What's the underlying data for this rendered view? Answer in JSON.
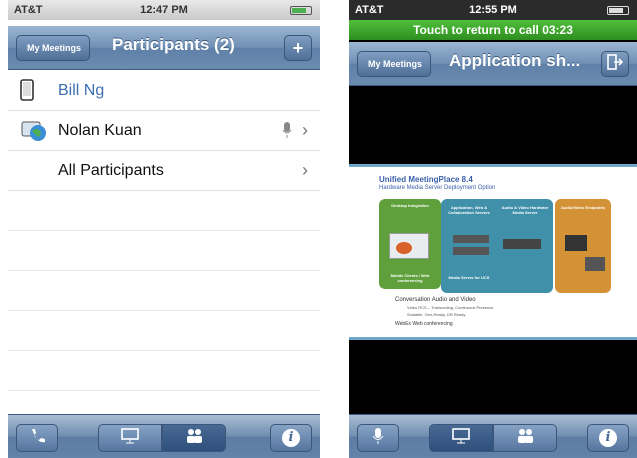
{
  "left": {
    "status": {
      "carrier": "AT&T",
      "time": "12:47 PM"
    },
    "nav": {
      "back": "My Meetings",
      "title": "Participants (2)",
      "add": "+"
    },
    "participants": [
      {
        "name": "Bill Ng"
      },
      {
        "name": "Nolan Kuan"
      },
      {
        "name": "All Participants"
      }
    ]
  },
  "right": {
    "status": {
      "carrier": "AT&T",
      "time": "12:55 PM"
    },
    "banner": "Touch to return to call  03:23",
    "nav": {
      "back": "My Meetings",
      "title": "Application sh..."
    },
    "slide": {
      "title": "Unified MeetingPlace 8.4",
      "subtitle": "Hardware Media Server Deployment Option",
      "panels": {
        "desktop": "Desktop Integration",
        "app_sharing": "Application, Web & Collaboration Servers",
        "audio_video": "Audio & Video Hardware Media Server",
        "endpoints": "Audio/Video Endpoints",
        "mobile": "Mobile Clients / Web conferencing",
        "media_server": "Media Server for UCS"
      },
      "bullets": {
        "main": "Conversation Audio and Video",
        "sub1": "Video RCS – Transcoding, Continuous Presence",
        "sub2": "Scalable, Geo-Ready, DR Ready",
        "footer": "WebEx Web conferencing"
      }
    }
  },
  "colors": {
    "nav": "#6f8fb4",
    "banner": "#3ea52d",
    "slide_blue": "#3a5fa8",
    "slide_teal": "#3f90a8",
    "slide_orange": "#d49237"
  }
}
